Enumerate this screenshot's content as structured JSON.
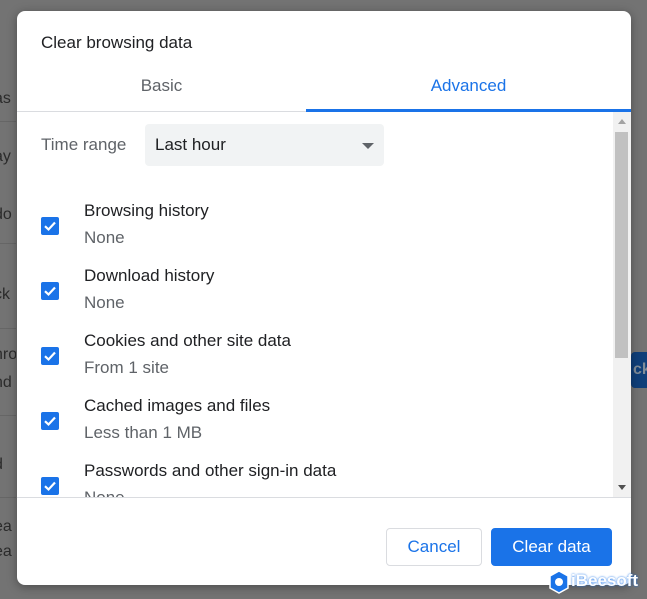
{
  "dialog": {
    "title": "Clear browsing data",
    "tabs": [
      {
        "label": "Basic",
        "active": false
      },
      {
        "label": "Advanced",
        "active": true
      }
    ],
    "time_range": {
      "label": "Time range",
      "selected": "Last hour"
    },
    "options": [
      {
        "title": "Browsing history",
        "subtitle": "None",
        "checked": true
      },
      {
        "title": "Download history",
        "subtitle": "None",
        "checked": true
      },
      {
        "title": "Cookies and other site data",
        "subtitle": "From 1 site",
        "checked": true
      },
      {
        "title": "Cached images and files",
        "subtitle": "Less than 1 MB",
        "checked": true
      },
      {
        "title": "Passwords and other sign-in data",
        "subtitle": "None",
        "checked": true
      }
    ],
    "buttons": {
      "cancel": "Cancel",
      "clear": "Clear data"
    }
  },
  "background": {
    "fragments": [
      "as",
      "ay",
      "do",
      "ck",
      "hro",
      "nd",
      "d",
      "ea",
      "ea"
    ],
    "right_button": "ck"
  },
  "watermark": {
    "text": "iBeesoft"
  },
  "colors": {
    "accent": "#1a73e8",
    "text_primary": "#202124",
    "text_secondary": "#5f6368",
    "overlay": "#737373"
  }
}
